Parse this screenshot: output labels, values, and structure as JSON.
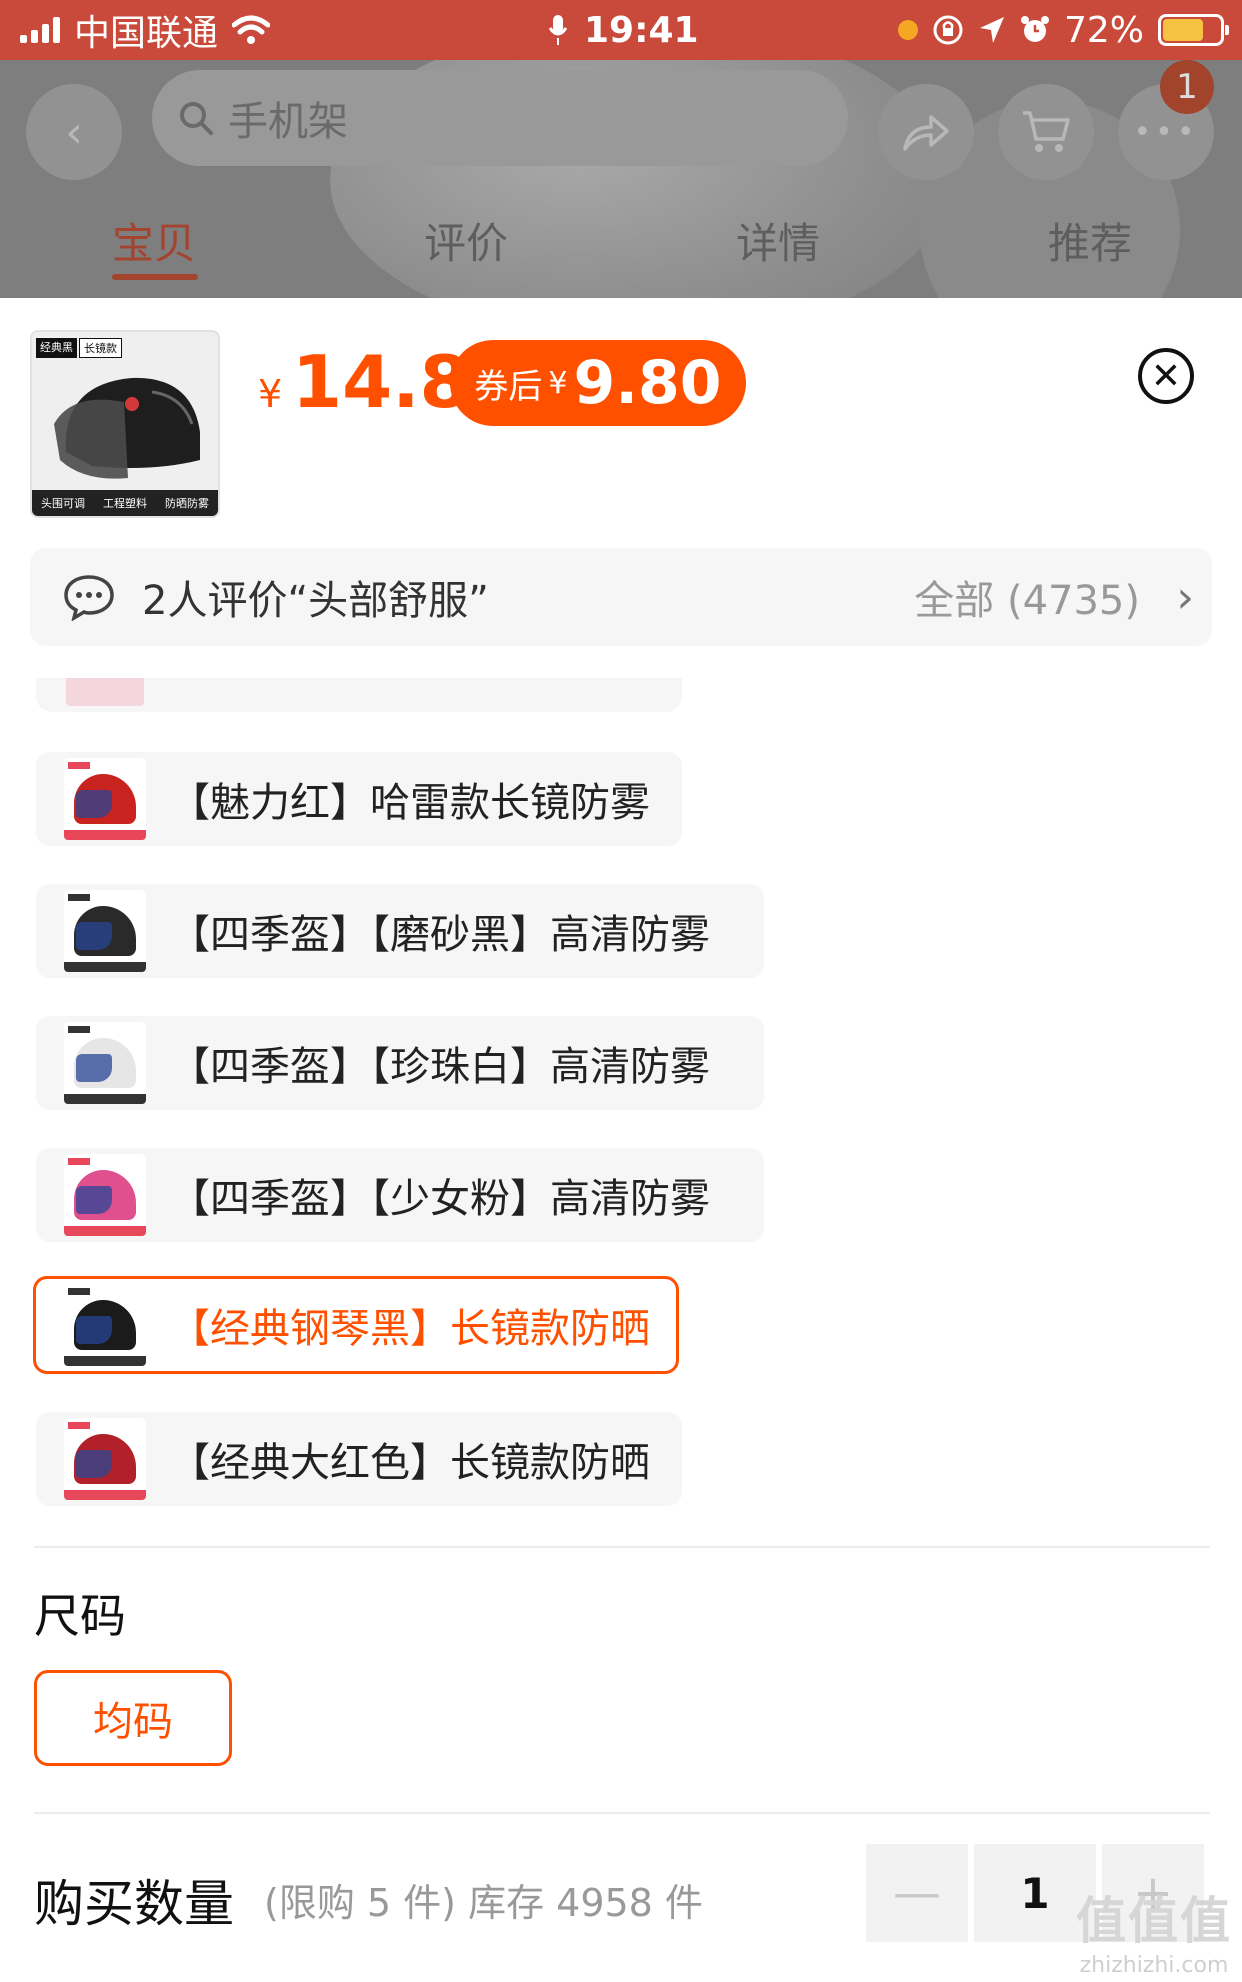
{
  "status_bar": {
    "carrier": "中国联通",
    "time": "19:41",
    "battery": "72%",
    "battery_level": 0.72,
    "icons": [
      "signal-icon",
      "wifi-icon",
      "mic-icon",
      "orange-dot-icon",
      "lock-rotation-icon",
      "location-icon",
      "alarm-icon",
      "battery-charging-icon"
    ]
  },
  "header": {
    "search_placeholder": "手机架",
    "cart_badge": "1",
    "tabs": [
      {
        "label": "宝贝",
        "active": true
      },
      {
        "label": "评价",
        "active": false
      },
      {
        "label": "详情",
        "active": false
      },
      {
        "label": "推荐",
        "active": false
      }
    ]
  },
  "product": {
    "thumb_tags": [
      "经典黑",
      "长镜款"
    ],
    "thumb_footer": [
      "头围可调",
      "工程塑料",
      "防晒防雾"
    ],
    "price_symbol": "¥",
    "price": "14.8",
    "coupon_label": "券后",
    "coupon_symbol": "¥",
    "coupon_price": "9.80"
  },
  "review": {
    "text": "2人评价“头部舒服”",
    "all_label": "全部 (4735)"
  },
  "skus": [
    {
      "label": "【魅力红】哈雷款长镜防雾",
      "selected": false,
      "helmet_color": "#c8231f",
      "strip_color": "#e8475a"
    },
    {
      "label": "【四季盔】【磨砂黑】高清防雾",
      "selected": false,
      "helmet_color": "#2a2a2a",
      "strip_color": "#333333"
    },
    {
      "label": "【四季盔】【珍珠白】高清防雾",
      "selected": false,
      "helmet_color": "#e6e6e6",
      "strip_color": "#333333"
    },
    {
      "label": "【四季盔】【少女粉】高清防雾",
      "selected": false,
      "helmet_color": "#e0508e",
      "strip_color": "#e8475a"
    },
    {
      "label": "【经典钢琴黑】长镜款防晒",
      "selected": true,
      "helmet_color": "#1b1b1b",
      "strip_color": "#333333"
    },
    {
      "label": "【经典大红色】长镜款防晒",
      "selected": false,
      "helmet_color": "#b2202a",
      "strip_color": "#e8475a"
    }
  ],
  "size": {
    "title": "尺码",
    "option": "均码"
  },
  "quantity": {
    "title": "购买数量",
    "note": "(限购 5 件) 库存 4958 件",
    "minus": "—",
    "value": "1",
    "plus": "+"
  },
  "watermark": {
    "big": "值值值",
    "small": "zhizhizhi.com"
  }
}
